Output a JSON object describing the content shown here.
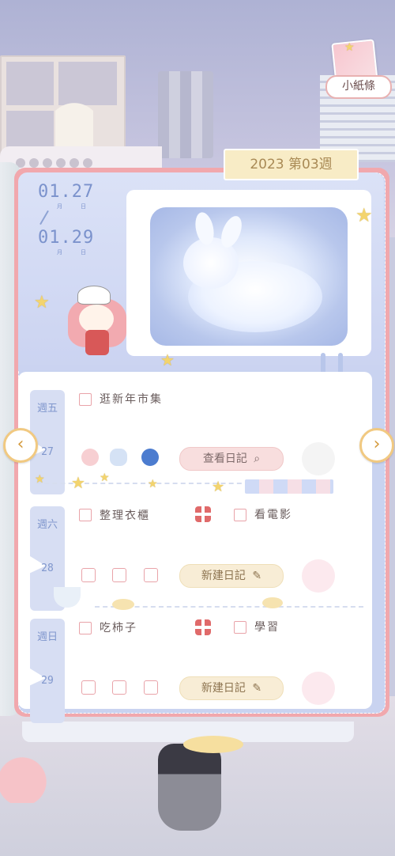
{
  "header": {
    "week_label": "2023 第03週",
    "note_label": "小紙條"
  },
  "date_range": {
    "start": "01.27",
    "start_month": "月",
    "start_day": "日",
    "end": "01.29",
    "end_month": "月",
    "end_day": "日"
  },
  "days": [
    {
      "weekday": "週五",
      "day": "27",
      "tasks": [
        "逛新年市集"
      ],
      "button": "查看日記"
    },
    {
      "weekday": "週六",
      "day": "28",
      "tasks": [
        "整理衣櫃",
        "看電影"
      ],
      "button": "新建日記"
    },
    {
      "weekday": "週日",
      "day": "29",
      "tasks": [
        "吃柿子",
        "學習"
      ],
      "button": "新建日記"
    }
  ],
  "colors": {
    "card_border": "#f1a8ad",
    "panel_blue": "#c9d3f0",
    "date_blue": "#7b92cc",
    "accent_gold": "#f1c981"
  },
  "icons": {
    "prev": "chevron-left-icon",
    "next": "chevron-right-icon",
    "search": "search-icon",
    "edit": "edit-icon",
    "gift": "gift-icon"
  },
  "arrows": {
    "prev_glyph": "‹",
    "next_glyph": "›"
  }
}
